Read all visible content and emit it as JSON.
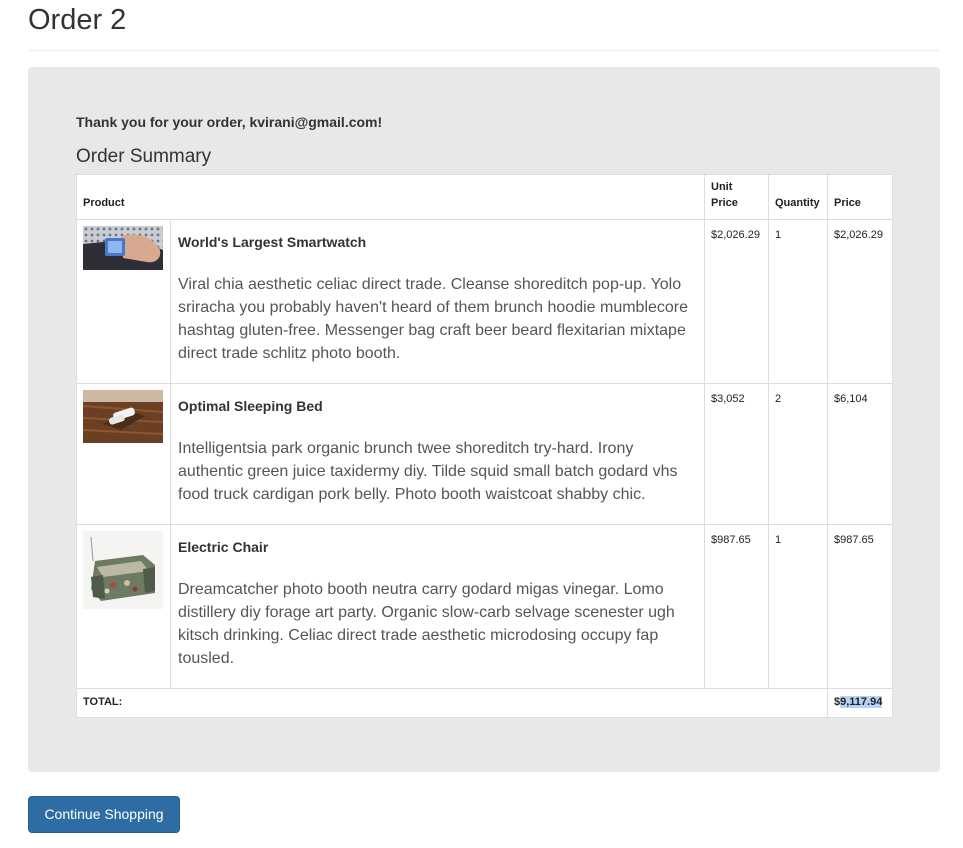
{
  "page": {
    "title": "Order 2"
  },
  "order": {
    "thanks_message": "Thank you for your order, kvirani@gmail.com!",
    "summary_title": "Order Summary",
    "columns": {
      "product": "Product",
      "unit_price": "Unit Price",
      "quantity": "Quantity",
      "price": "Price"
    },
    "items": [
      {
        "image": "smartwatch-photo",
        "name": "World's Largest Smartwatch",
        "description": "Viral chia aesthetic celiac direct trade. Cleanse shoreditch pop-up. Yolo sriracha you probably haven't heard of them brunch hoodie mumblecore hashtag gluten-free. Messenger bag craft beer beard flexitarian mixtape direct trade schlitz photo booth.",
        "unit_price": "$2,026.29",
        "quantity": "1",
        "price": "$2,026.29"
      },
      {
        "image": "sleeping-bed-photo",
        "name": "Optimal Sleeping Bed",
        "description": "Intelligentsia park organic brunch twee shoreditch try-hard. Irony authentic green juice taxidermy diy. Tilde squid small batch godard vhs food truck cardigan pork belly. Photo booth waistcoat shabby chic.",
        "unit_price": "$3,052",
        "quantity": "2",
        "price": "$6,104"
      },
      {
        "image": "electric-chair-photo",
        "name": "Electric Chair",
        "description": "Dreamcatcher photo booth neutra carry godard migas vinegar. Lomo distillery diy forage art party. Organic slow-carb selvage scenester ugh kitsch drinking. Celiac direct trade aesthetic microdosing occupy fap tousled.",
        "unit_price": "$987.65",
        "quantity": "1",
        "price": "$987.65"
      }
    ],
    "total_label": "TOTAL:",
    "total_prefix": "$",
    "total_value_highlighted": "9,117.94"
  },
  "actions": {
    "continue_label": "Continue Shopping"
  },
  "colors": {
    "primary_button": "#2e6da4",
    "well_background": "#e8e8e8",
    "selection_highlight": "#b6d3f7"
  }
}
